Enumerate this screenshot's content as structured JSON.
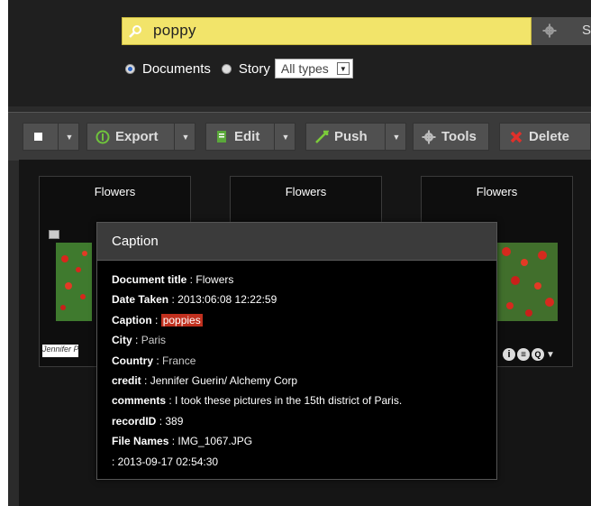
{
  "search": {
    "value": "poppy"
  },
  "gear_label": "S",
  "scope": {
    "documents": "Documents",
    "story": "Story",
    "type_select": "All types"
  },
  "toolbar": {
    "export": "Export",
    "edit": "Edit",
    "push": "Push",
    "tools": "Tools",
    "delete": "Delete"
  },
  "cards": [
    {
      "title": "Flowers"
    },
    {
      "title": "Flowers"
    },
    {
      "title": "Flowers"
    }
  ],
  "signature": "Jennifer Pr",
  "popup": {
    "title": "Caption",
    "fields": [
      {
        "label": "Document title",
        "value": "Flowers"
      },
      {
        "label": "Date Taken",
        "value": "2013:06:08 12:22:59"
      },
      {
        "label": "Caption",
        "value": "poppies"
      },
      {
        "label": "City",
        "value": "Paris"
      },
      {
        "label": "Country",
        "value": "France"
      },
      {
        "label": "credit",
        "value": "Jennifer Guerin/ Alchemy Corp"
      },
      {
        "label": "comments",
        "value": "I took these pictures in the 15th district of Paris."
      },
      {
        "label": "recordID",
        "value": "389"
      },
      {
        "label": "File Names",
        "value": "IMG_1067.JPG"
      },
      {
        "label": "",
        "value": "2013-09-17 02:54:30"
      }
    ]
  }
}
